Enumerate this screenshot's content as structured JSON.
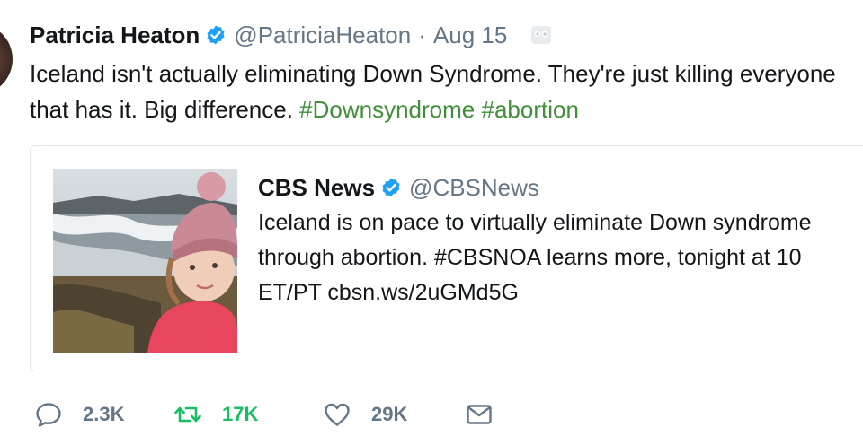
{
  "tweet": {
    "author_name": "Patricia Heaton",
    "handle": "@PatriciaHeaton",
    "separator": "·",
    "date": "Aug 15",
    "text_line1": "Iceland isn't actually eliminating Down Syndrome. They're just killing everyone",
    "text_line2_prefix": "that has it. Big difference.",
    "hashtags": [
      "#Downsyndrome",
      "#abortion"
    ]
  },
  "quoted_tweet": {
    "author_name": "CBS News",
    "handle": "@CBSNews",
    "lines": [
      "Iceland is on pace to virtually eliminate Down syndrome",
      "through abortion. #CBSNOA learns more, tonight at 10",
      "ET/PT cbsn.ws/2uGMd5G"
    ]
  },
  "actions": {
    "reply_count": "2.3K",
    "retweet_count": "17K",
    "like_count": "29K"
  },
  "colors": {
    "hashtag": "#3f8f39",
    "retweet": "#17bf63",
    "verified": "#1da1f2",
    "muted": "#657786"
  }
}
